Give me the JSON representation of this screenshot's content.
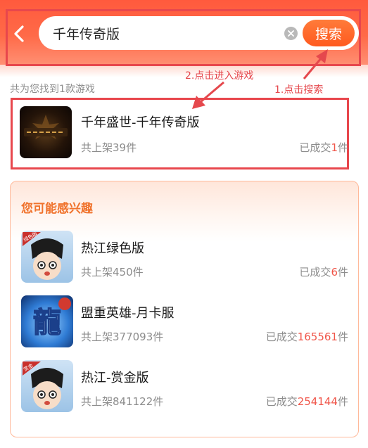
{
  "search": {
    "query": "千年传奇版",
    "button_label": "搜索"
  },
  "results": {
    "count_text": "共为您找到1款游戏",
    "items": [
      {
        "name": "千年盛世-千年传奇版",
        "stock": "共上架39件",
        "sold_prefix": "已成交",
        "sold_num": "1",
        "sold_suffix": "件"
      }
    ]
  },
  "annotations": {
    "step1": "1.点击搜索",
    "step2": "2.点击进入游戏"
  },
  "recommend": {
    "title": "您可能感兴趣",
    "items": [
      {
        "name": "热江绿色版",
        "stock": "共上架450件",
        "sold_prefix": "已成交",
        "sold_num": "6",
        "sold_suffix": "件",
        "badge": "绿色版"
      },
      {
        "name": "盟重英雄-月卡服",
        "stock": "共上架377093件",
        "sold_prefix": "已成交",
        "sold_num": "165561",
        "sold_suffix": "件",
        "badge": "龍"
      },
      {
        "name": "热江-赏金版",
        "stock": "共上架841122件",
        "sold_prefix": "已成交",
        "sold_num": "254144",
        "sold_suffix": "件",
        "badge": "赏金"
      }
    ]
  },
  "colors": {
    "header": "#ff5a3d",
    "accent": "#f0732d",
    "highlight": "#f0564a",
    "annotation": "#e5484d"
  }
}
